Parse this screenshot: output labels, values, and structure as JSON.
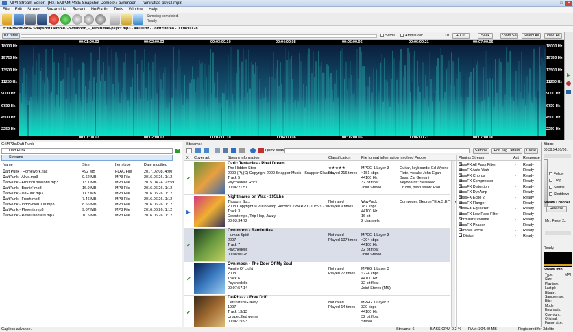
{
  "window": {
    "title": "MP4 Stream Editor - [H:\\TEMP\\MP4SE Snapshot Demo\\07-ovnimoon_-_ramirufias-psycz.mp3]"
  },
  "menu": [
    "File",
    "Edit",
    "Stream",
    "Stream List",
    "Recent",
    "NetRadio",
    "Tools",
    "Window",
    "Help"
  ],
  "toolbar": {
    "status_line1": "Sampling completed.",
    "status_line2": "Ready."
  },
  "file_path": "H:\\TEMP\\MP4SE Snapshot Demo\\07-ovnimoon_-_ramirufias-psycz.mp3 - 44100Hz - Joint Stereo - 00:08:00.28",
  "spectrum_controls": {
    "bitrates": "Bit rates",
    "scroll": "Scroll",
    "amplitude": "Amplitude:",
    "zoom": "1.0x",
    "cut": "+ Cut",
    "seek": "Seek",
    "zoom_sel": "Zoom Sel",
    "select_all": "Select All",
    "view_all": "View All"
  },
  "spectrogram": {
    "freq_labels": [
      "18000 Hz",
      "15750 Hz",
      "13500 Hz",
      "11250 Hz",
      "9000 Hz",
      "6750 Hz",
      "4500 Hz",
      "2250 Hz"
    ],
    "time_labels": [
      "00:01:00.03",
      "00:02:00.03",
      "00:03:00.10",
      "00:04:00.08",
      "00:05:00.06",
      "00:06:00.21",
      "00:07:00.06"
    ]
  },
  "left": {
    "path": "G:\\MP3s\\Daft Punk",
    "folder": "Daft Punk",
    "streams": "Streams",
    "columns": [
      "Name",
      "Size",
      "Item type",
      "Date modified"
    ],
    "files": [
      [
        "Daft Punk - Homework.flac",
        "492 MB",
        "FLAC File",
        "2017.02.08. 4:00"
      ],
      [
        "DaftPunk - Alive.mp3",
        "9.62 MB",
        "MP3 File",
        "2016.06.26. 1:12"
      ],
      [
        "DaftPunk - AroundTheWorld.mp3",
        "13.1 MB",
        "MP3 File",
        "2015.04.24. 23:59"
      ],
      [
        "DaftPunk - Burnin'.mp3",
        "16.9 MB",
        "MP3 File",
        "2016.06.26. 1:12"
      ],
      [
        "DaftPunk - DaFunk.mp3",
        "11.2 MB",
        "MP3 File",
        "2016.06.26. 1:12"
      ],
      [
        "DaftPunk - Fresh.mp3",
        "7.46 MB",
        "MP3 File",
        "2016.06.26. 1:12"
      ],
      [
        "DaftPunk - IndoSilverClub.mp3",
        "8.66 MB",
        "MP3 File",
        "2016.06.26. 1:12"
      ],
      [
        "DaftPunk - Phoenix.mp3",
        "9.07 MB",
        "MP3 File",
        "2016.06.26. 1:12"
      ],
      [
        "DaftPunk - Revolution909.mp3",
        "10.5 MB",
        "MP3 File",
        "2016.06.26. 1:12"
      ]
    ]
  },
  "streams": {
    "label": "Streams:",
    "quick_search": "Quick search:",
    "sample": "Sample",
    "edit_tags": "Edit Tag Details",
    "close": "Close",
    "columns": [
      "Cover art",
      "Stream information",
      "Classification",
      "File format information",
      "Involved People"
    ],
    "rows": [
      {
        "title": "Ozric Tentacles - Pixel Dream",
        "lines": [
          "The Hidden Step",
          "2000 (P),(C) Copyright 2000 Snapper Music - Snapper Classics",
          "Track 5",
          "Psychedelic Rock",
          "00:06:21.51"
        ],
        "class": [
          "★★★★★",
          "Played 216 times"
        ],
        "format": [
          "MPEG 1 Layer 3",
          "~151 kbps",
          "44100 Hz",
          "32 bit float",
          "Joint Stereo"
        ],
        "people": [
          "Guitar, keyboards: Ed Wynne",
          "Flute, vocals: John Egan",
          "Bass: Zia Geelani",
          "Keyboards: Seaweed",
          "Drums, percussion: Rad"
        ]
      },
      {
        "title": "Nightmares on Wax - 195Lbs",
        "lines": [
          "Thought So...",
          "2008 Copyright © 2008 Warp Records <WARP CD 159> - W",
          "Track 3",
          "Downtempo, Trip Hop, Jazzy",
          "00:03:34.72"
        ],
        "class": [
          "Not rated",
          "Played 9 times"
        ],
        "format": [
          "WavPack",
          "787 kbps",
          "44100 Hz",
          "16 bit",
          "2 channels"
        ],
        "people": [
          "Composer: George \"E.A.S.E.\" Evel"
        ]
      },
      {
        "title": "Ovnimoon - Ramirufias",
        "lines": [
          "Human Spirit",
          "2007",
          "Track 7",
          "Psychedelic",
          "00:08:00.28"
        ],
        "class": [
          "Not rated",
          "Played 107 times"
        ],
        "format": [
          "MPEG 1 Layer 3",
          "~204 kbps",
          "44100 Hz",
          "32 bit float",
          "Joint Stereo"
        ],
        "people": []
      },
      {
        "title": "Ovnimoon - The Door Of My Soul",
        "lines": [
          "Family Of Light",
          "2008",
          "Track 6",
          "Psychedelic",
          "00:07:57.14"
        ],
        "class": [
          "Not rated",
          "Played 77 times"
        ],
        "format": [
          "MPEG 1 Layer 3",
          "~224 kbps",
          "44100 Hz",
          "32 bit float",
          "Joint Stereo (MS)"
        ],
        "people": []
      },
      {
        "title": "De-Phazz - Free Drift",
        "lines": [
          "Detunized Gravity",
          "1997",
          "Track 13/13",
          "Unspecified genre",
          "00:06:19.93"
        ],
        "class": [
          "Not rated",
          "Played 14 times"
        ],
        "format": [
          "MPEG 1 Layer 3",
          "320 kbps",
          "44100 Hz",
          "32 bit float",
          "Stereo"
        ],
        "people": []
      }
    ]
  },
  "plugins": {
    "columns": [
      "Plugins Stream",
      "Act",
      "Response"
    ],
    "items": [
      "BassFX All Pass Filter",
      "BassFX Auto Wah",
      "BassFX Chorus",
      "BassFX Compressor",
      "BassFX Distortion",
      "BassFX DynAmp",
      "BassFX Echo 2",
      "BassFX Flanger",
      "BassFX Equalizer",
      "BassFX Low Pass Filter",
      "Normalize Volume",
      "BassFX Phaser",
      "Remove Vocal",
      "UnDistort"
    ],
    "response": "Ready"
  },
  "mixer": {
    "label": "Mixer:",
    "time": "00:39:54.91/00:",
    "follow": "Follow",
    "loop": "Loop",
    "shuffle": "Shuffle",
    "shutdown": "Shutdown",
    "stream_channel": "Stream Channel",
    "release": "Release",
    "min_reset": "Min. Reset 2x",
    "ready": "Ready.",
    "info_title": "Stream Info:",
    "info_labels": [
      "Type:",
      "Size:",
      "Playtime:",
      "Last pl:",
      "Bitrate:",
      "Sample rate:",
      "Bits:",
      "Mode:",
      "Emphasis:",
      "Copyright:",
      "Original:",
      "Frame size:"
    ],
    "info_type_value": "MPI"
  },
  "status": {
    "left": "Gapless advance.",
    "streams": "Streams: 6",
    "cpu": "BASS CPU: 0.2 %",
    "ram": "RAM: 304.40 MB",
    "registered": "Registered for 3delite"
  },
  "colors": {
    "spectrum_low": "#00e6c8",
    "spectrum_high": "#0a1e3c",
    "selected_row": "#d9dee8"
  }
}
